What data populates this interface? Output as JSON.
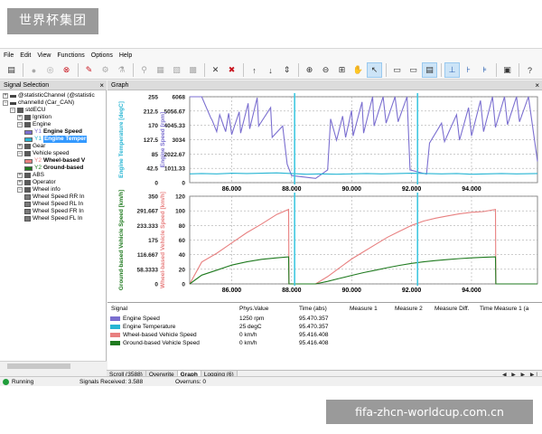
{
  "watermark": {
    "top": "世界杯集团",
    "bottom": "fifa-zhcn-worldcup.com.cn"
  },
  "menu": [
    "File",
    "Edit",
    "View",
    "Functions",
    "Options",
    "Help"
  ],
  "signal_panel": {
    "title": "Signal Selection",
    "tree": [
      {
        "label": "@statisticChannel  (@statistic"
      },
      {
        "label": "channelId  (Car_CAN)"
      },
      {
        "label": "stdECU"
      },
      {
        "label": "Ignition"
      },
      {
        "label": "Engine"
      },
      {
        "label": "Engine Speed",
        "prefix": "Y1"
      },
      {
        "label": "Engine Temper",
        "prefix": "Y1"
      },
      {
        "label": "Gear"
      },
      {
        "label": "Vehicle speed"
      },
      {
        "label": "Wheel-based V",
        "prefix": "Y2"
      },
      {
        "label": "Ground-based",
        "prefix": "Y2"
      },
      {
        "label": "ABS"
      },
      {
        "label": "Operator"
      },
      {
        "label": "Wheel info"
      },
      {
        "label": "Wheel Speed RR In"
      },
      {
        "label": "Wheel Speed RL In"
      },
      {
        "label": "Wheel Speed FR In"
      },
      {
        "label": "Wheel Speed FL In"
      }
    ]
  },
  "graph_panel": {
    "title": "Graph"
  },
  "chart_data": [
    {
      "type": "line",
      "xlim": [
        84.6,
        96.2
      ],
      "x_ticks": [
        "86.000",
        "88.000",
        "90.000",
        "92.000",
        "94.000"
      ],
      "cursors": [
        88.1,
        92.2
      ],
      "grid": true,
      "axes": [
        {
          "label": "Engine Temperature [degC]",
          "ticks": [
            "255",
            "212.5",
            "170",
            "127.5",
            "85",
            "42.5",
            "0"
          ],
          "ylim": [
            0,
            255
          ],
          "color": "#27b5d3"
        },
        {
          "label": "Engine Speed [rpm]",
          "ticks": [
            "6068",
            "5056.67",
            "4045.33",
            "3034",
            "2022.67",
            "1011.33",
            "0"
          ],
          "ylim": [
            0,
            6068
          ],
          "color": "#7b6fd0"
        }
      ],
      "series": [
        {
          "name": "Engine Speed",
          "color": "#7b6fd0",
          "axis": 1,
          "x": [
            84.6,
            85.0,
            85.3,
            85.35,
            85.5,
            85.6,
            85.8,
            85.9,
            86.0,
            86.25,
            86.3,
            86.55,
            86.6,
            86.85,
            86.9,
            87.3,
            87.35,
            87.7,
            87.85,
            88.0,
            88.8,
            89.2,
            89.3,
            89.5,
            89.7,
            89.8,
            90.0,
            90.05,
            90.35,
            90.4,
            90.7,
            90.75,
            91.05,
            91.15,
            91.45,
            91.55,
            91.85,
            91.95,
            92.5,
            92.6,
            93.0,
            93.1,
            93.5,
            93.6,
            93.9,
            94.0,
            94.3,
            94.4,
            94.7,
            94.8,
            95.1,
            95.2,
            95.5,
            95.6,
            95.9,
            96.2
          ],
          "y": [
            6068,
            6068,
            4600,
            4400,
            3600,
            4800,
            3600,
            4900,
            3400,
            5000,
            3500,
            5600,
            3800,
            6000,
            4000,
            5300,
            3200,
            4000,
            1300,
            500,
            300,
            900,
            4500,
            3000,
            4700,
            3200,
            5100,
            3300,
            5700,
            3500,
            6068,
            4000,
            6068,
            4200,
            6068,
            4300,
            6068,
            900,
            600,
            2800,
            4200,
            2900,
            4800,
            3000,
            5300,
            3300,
            5800,
            3600,
            6068,
            3900,
            6068,
            4100,
            6068,
            4300,
            6068,
            1500
          ]
        },
        {
          "name": "Engine Temperature",
          "color": "#27b5d3",
          "axis": 0,
          "x": [
            84.6,
            85.0,
            85.5,
            86.0,
            86.5,
            87.0,
            87.5,
            88.0,
            88.5,
            89.0,
            89.5,
            90.0,
            90.5,
            91.0,
            91.5,
            92.0,
            92.5,
            93.0,
            93.5,
            94.0,
            94.5,
            95.0,
            95.5,
            96.2
          ],
          "y": [
            26,
            27,
            26,
            28,
            27,
            28,
            29,
            27,
            25,
            26,
            25,
            26,
            27,
            26,
            27,
            28,
            27,
            26,
            27,
            25,
            26,
            27,
            26,
            27
          ]
        }
      ]
    },
    {
      "type": "line",
      "xlim": [
        84.6,
        96.2
      ],
      "x_ticks": [
        "86.000",
        "88.000",
        "90.000",
        "92.000",
        "94.000"
      ],
      "cursors": [
        88.1,
        92.2
      ],
      "grid": true,
      "axes": [
        {
          "label": "Ground-based Vehicle Speed [km/h]",
          "ticks": [
            "350",
            "291.667",
            "233.333",
            "175",
            "116.667",
            "58.3333",
            "0"
          ],
          "ylim": [
            0,
            350
          ],
          "color": "#1f7a1f"
        },
        {
          "label": "Wheel-based Vehicle Speed [km/h]",
          "ticks": [
            "120",
            "100",
            "80",
            "60",
            "40",
            "20",
            "0"
          ],
          "ylim": [
            0,
            120
          ],
          "color": "#e88080"
        }
      ],
      "series": [
        {
          "name": "Wheel-based Vehicle Speed",
          "color": "#e88080",
          "axis": 1,
          "x": [
            84.6,
            85.0,
            85.5,
            86.0,
            86.5,
            87.0,
            87.5,
            87.9,
            87.91,
            88.8,
            89.2,
            89.6,
            90.0,
            90.4,
            90.8,
            91.2,
            91.6,
            92.0,
            92.4,
            92.8,
            93.2,
            93.6,
            94.0,
            94.4,
            94.8,
            94.81,
            96.2
          ],
          "y": [
            0,
            30,
            42,
            56,
            70,
            82,
            95,
            102,
            0,
            0,
            10,
            22,
            34,
            44,
            54,
            64,
            72,
            80,
            86,
            90,
            93,
            96,
            98,
            99,
            102,
            0,
            0
          ]
        },
        {
          "name": "Ground-based Vehicle Speed",
          "color": "#1f7a1f",
          "axis": 0,
          "x": [
            84.6,
            85.0,
            85.5,
            86.0,
            86.5,
            87.0,
            87.5,
            87.9,
            87.91,
            88.8,
            89.2,
            89.6,
            90.0,
            90.4,
            90.8,
            91.2,
            91.6,
            92.0,
            92.4,
            92.8,
            93.2,
            93.6,
            94.0,
            94.4,
            94.8,
            94.81,
            96.2
          ],
          "y": [
            0,
            35,
            55,
            75,
            88,
            98,
            104,
            108,
            0,
            0,
            10,
            22,
            34,
            45,
            55,
            65,
            74,
            82,
            88,
            93,
            97,
            101,
            104,
            106,
            108,
            0,
            0
          ]
        }
      ]
    }
  ],
  "legend_table": {
    "headers": [
      "Signal",
      "Phys.Value",
      "Time (abs)",
      "Measure 1",
      "Measure 2",
      "Measure Diff.",
      "Time Measure 1 (a"
    ],
    "rows": [
      {
        "signal": "Engine Speed",
        "value": "1250 rpm",
        "time": "95.470.357",
        "color": "#7b6fd0"
      },
      {
        "signal": "Engine Temperature",
        "value": "25 degC",
        "time": "95.470.357",
        "color": "#27b5d3"
      },
      {
        "signal": "Wheel-based Vehicle Speed",
        "value": "0 km/h",
        "time": "95.416.408",
        "color": "#e88080"
      },
      {
        "signal": "Ground-based Vehicle Speed",
        "value": "0 km/h",
        "time": "95.416.408",
        "color": "#1f7a1f"
      }
    ]
  },
  "tabs": [
    "Scroll (3588)",
    "Overwrite",
    "Graph",
    "Logging (6)"
  ],
  "status": {
    "state": "Running",
    "received": "Signals Received: 3.588",
    "overruns": "Overruns: 0"
  }
}
